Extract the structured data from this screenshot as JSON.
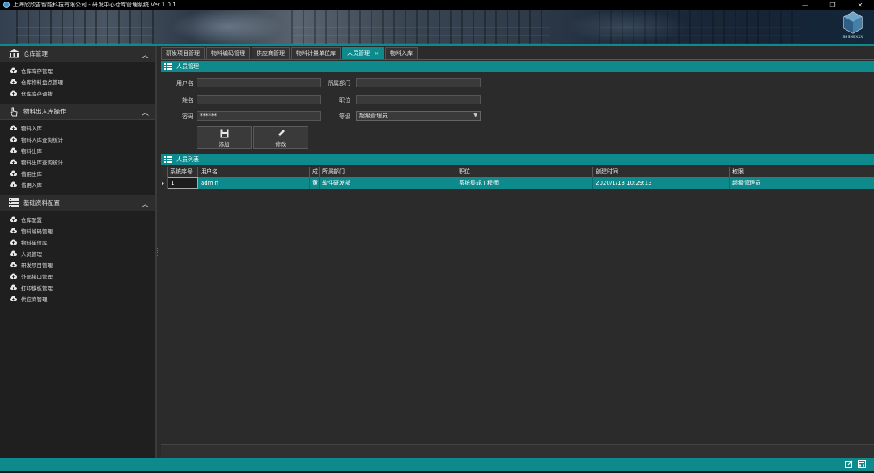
{
  "window": {
    "title": "上海欣欣吉智能科技有限公司 - 研发中心仓库管理系统 Ver 1.0.1",
    "controls": [
      "—",
      "❐",
      "✕"
    ]
  },
  "banner": {
    "logo_text": "SHSMBXXX"
  },
  "sidebar": {
    "groups": [
      {
        "label": "仓库管理",
        "icon": "warehouse-icon",
        "items": [
          "仓库库存管理",
          "仓库物料盘点管理",
          "仓库库存调拨"
        ]
      },
      {
        "label": "物料出入库操作",
        "icon": "hand-pointer-icon",
        "items": [
          "物料入库",
          "物料入库查询统计",
          "物料出库",
          "物料出库查询统计",
          "借用出库",
          "借用入库"
        ]
      },
      {
        "label": "基础资料配置",
        "icon": "database-icon",
        "items": [
          "仓库配置",
          "物料编码管理",
          "物料单位库",
          "人员管理",
          "研发项目管理",
          "外部接口管理",
          "打印模板管理",
          "供应商管理"
        ]
      }
    ]
  },
  "tabs": [
    {
      "label": "研发项目管理",
      "active": false
    },
    {
      "label": "物料编码管理",
      "active": false
    },
    {
      "label": "供应商管理",
      "active": false
    },
    {
      "label": "物料计量单位库",
      "active": false
    },
    {
      "label": "人员管理",
      "active": true,
      "closable": true
    },
    {
      "label": "物料入库",
      "active": false
    }
  ],
  "form_panel": {
    "title": "人员管理",
    "fields": {
      "username": {
        "label": "用户名",
        "value": ""
      },
      "department": {
        "label": "所属部门",
        "value": ""
      },
      "name": {
        "label": "姓名",
        "value": ""
      },
      "position": {
        "label": "职位",
        "value": ""
      },
      "password": {
        "label": "密码",
        "value": "******"
      },
      "level": {
        "label": "等级",
        "value": "超级管理员"
      }
    },
    "buttons": {
      "add": "添加",
      "edit": "修改"
    }
  },
  "list_panel": {
    "title": "人员列表",
    "columns": [
      "系统序号",
      "用户名",
      "成",
      "所属部门",
      "职位",
      "创建时间",
      "权限"
    ],
    "rows": [
      [
        "1",
        "admin",
        "黄",
        "软件研发部",
        "系统集成工程师",
        "2020/1/13 10:29:13",
        "超级管理员"
      ]
    ]
  },
  "colors": {
    "accent": "#0f8a8c",
    "background": "#2b2b2b",
    "sidebar": "#1f1f1f"
  }
}
